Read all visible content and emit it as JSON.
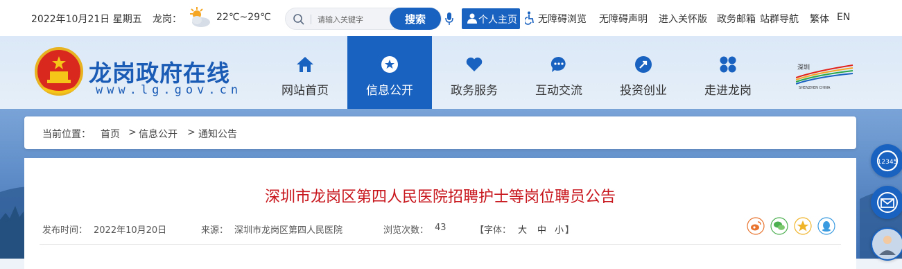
{
  "topbar": {
    "date": "2022年10月21日 星期五",
    "city": "龙岗：",
    "weather_icon": "partly-cloudy-icon",
    "temp": "22℃~29℃",
    "search_placeholder": "请输入关键字",
    "search_button": "搜索",
    "home_button": "个人主页",
    "links": [
      "无障碍浏览",
      "无障碍声明",
      "进入关怀版",
      "政务邮箱",
      "站群导航",
      "繁体",
      "EN"
    ]
  },
  "header": {
    "site_name": "龙岗政府在线",
    "site_url": "www.lg.gov.cn",
    "nav": [
      {
        "label": "网站首页",
        "icon": "home-icon"
      },
      {
        "label": "信息公开",
        "icon": "info-star-icon",
        "active": true
      },
      {
        "label": "政务服务",
        "icon": "heart-icon"
      },
      {
        "label": "互动交流",
        "icon": "chat-icon"
      },
      {
        "label": "投资创业",
        "icon": "rocket-icon"
      },
      {
        "label": "走进龙岗",
        "icon": "grid-icon"
      }
    ],
    "right_logo_text": "深圳 SHENZHEN CHINA"
  },
  "breadcrumb": {
    "prefix": "当前位置：",
    "items": [
      "首页",
      "信息公开",
      "通知公告"
    ],
    "separator": ">"
  },
  "article": {
    "title": "深圳市龙岗区第四人民医院招聘护士等岗位聘员公告",
    "publish_label": "发布时间：",
    "publish_date": "2022年10月20日",
    "source_label": "来源：",
    "source": "深圳市龙岗区第四人民医院",
    "views_label": "浏览次数：",
    "views": "43",
    "font_label": "【字体：",
    "font_large": "大",
    "font_medium": "中",
    "font_small": "小",
    "font_close": "】",
    "share_icons": [
      "weibo-icon",
      "wechat-icon",
      "qzone-icon",
      "qq-icon"
    ]
  },
  "float": {
    "hotline": "12345",
    "items": [
      "hotline-12345-icon",
      "mail-icon",
      "elderly-care-icon"
    ]
  },
  "colors": {
    "primary": "#1a62c0",
    "title_red": "#c8161d"
  }
}
